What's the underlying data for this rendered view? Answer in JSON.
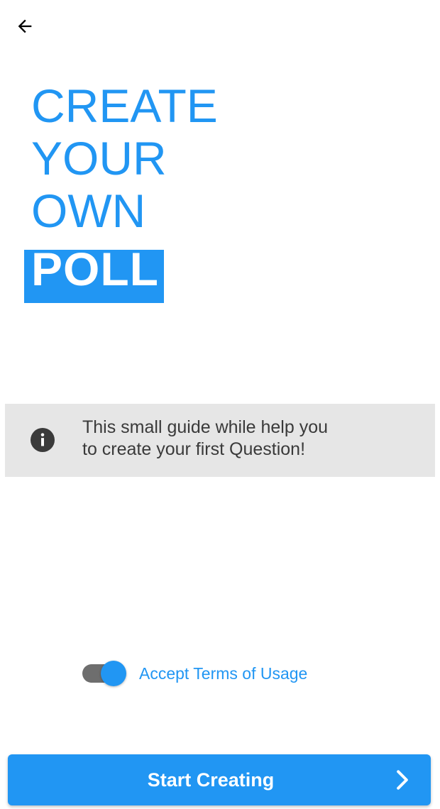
{
  "header": {
    "back_icon": "arrow-left-icon"
  },
  "hero": {
    "lines": [
      "CREATE",
      "YOUR",
      "OWN"
    ],
    "highlight": "POLL",
    "color": "#2196f3"
  },
  "info": {
    "icon": "info-icon",
    "line1": "This small guide while help you",
    "line2": "to create your first Question!",
    "background": "#e6e6e6"
  },
  "terms": {
    "toggle_on": true,
    "label": "Accept Terms of Usage"
  },
  "cta": {
    "label": "Start Creating",
    "icon": "chevron-right-icon",
    "color": "#2196f3"
  }
}
